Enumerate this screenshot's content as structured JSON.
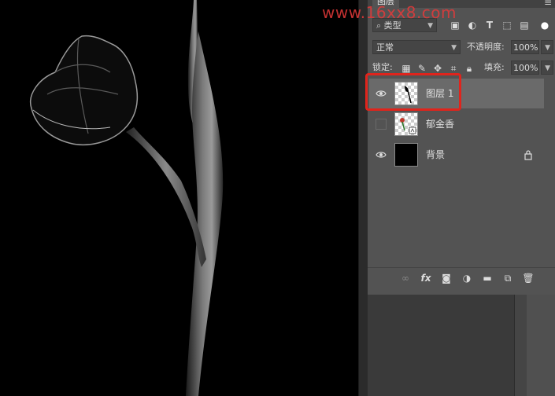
{
  "panel": {
    "tab_label": "图层",
    "menu_icon": "hamburger-icon",
    "filter": {
      "kind_label": "类型",
      "icons": [
        "image-filter-icon",
        "adjustment-filter-icon",
        "text-filter-icon",
        "shape-filter-icon",
        "smart-object-filter-icon"
      ]
    },
    "blend_mode": "正常",
    "opacity_label": "不透明度:",
    "opacity_value": "100%",
    "lock_label": "锁定:",
    "lock_icons": [
      "lock-transparent-icon",
      "lock-image-icon",
      "lock-position-icon",
      "lock-artboard-icon",
      "lock-all-icon"
    ],
    "fill_label": "填充:",
    "fill_value": "100%",
    "layers": [
      {
        "name": "图层 1",
        "visible": true,
        "selected": true
      },
      {
        "name": "郁金香",
        "visible": false,
        "selected": false
      },
      {
        "name": "背景",
        "visible": true,
        "selected": false,
        "locked": true
      }
    ],
    "footer_icons": [
      "link-layers-icon",
      "fx-icon",
      "layer-mask-icon",
      "adjustment-layer-icon",
      "group-folder-icon",
      "new-layer-icon",
      "trash-icon"
    ]
  },
  "watermark": "www.16xx8.com",
  "colors": {
    "canvas": "#000000",
    "panel": "#535353",
    "selected_layer": "#6a6a6a",
    "highlight": "#e0241c"
  }
}
